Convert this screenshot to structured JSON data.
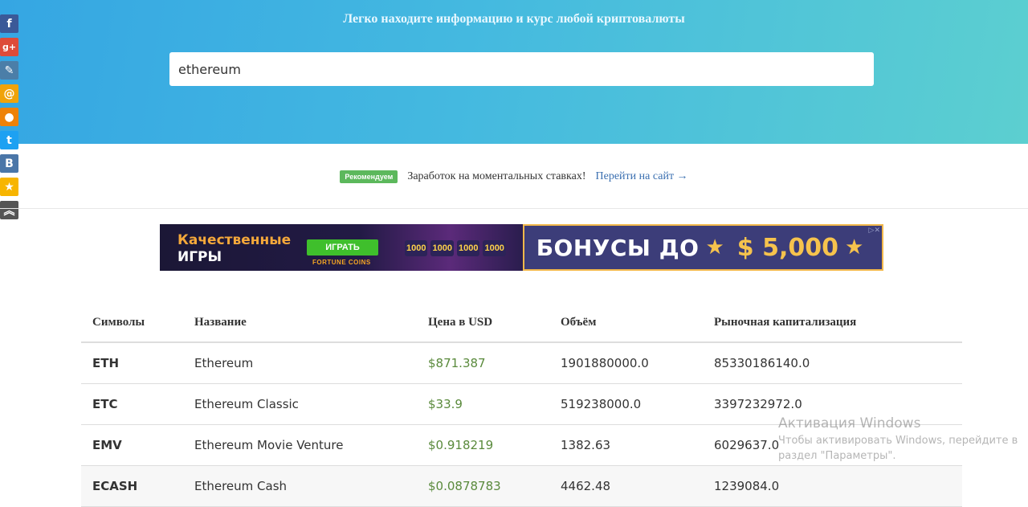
{
  "hero": {
    "subtitle": "Легко находите информацию и курс любой криптовалюты",
    "search_value": "ethereum"
  },
  "social": [
    {
      "icon": "facebook-icon",
      "glyph": "f",
      "color": "#3b5998"
    },
    {
      "icon": "google-plus-icon",
      "glyph": "g+",
      "color": "#dd4b39"
    },
    {
      "icon": "livejournal-icon",
      "glyph": "✎",
      "color": "#4b7ea8"
    },
    {
      "icon": "mail-ru-icon",
      "glyph": "@",
      "color": "#f0a30a"
    },
    {
      "icon": "odnoklassniki-icon",
      "glyph": "●",
      "color": "#ee8208"
    },
    {
      "icon": "twitter-icon",
      "glyph": "t",
      "color": "#1da1f2"
    },
    {
      "icon": "vk-icon",
      "glyph": "B",
      "color": "#4a76a8"
    },
    {
      "icon": "bookmark-star-icon",
      "glyph": "★",
      "color": "#f7b500"
    },
    {
      "icon": "scroll-up-icon",
      "glyph": "︽",
      "color": "#555555"
    }
  ],
  "promo": {
    "badge": "Рекомендуем",
    "text": "Заработок на моментальных ставках!",
    "link": "Перейти на сайт →"
  },
  "banner": {
    "left_title_1": "Качественные",
    "left_title_2": "ИГРЫ",
    "left_button": "ИГРАТЬ",
    "left_brand": "FORTUNE COINS",
    "reels": [
      "1000",
      "1000",
      "1000",
      "1000"
    ],
    "right_text": "БОНУСЫ ДО",
    "right_amount": "$ 5,000"
  },
  "table": {
    "headers": [
      "Символы",
      "Название",
      "Цена в USD",
      "Объём",
      "Рыночная капитализация"
    ],
    "rows": [
      {
        "symbol": "ETH",
        "name": "Ethereum",
        "price": "$871.387",
        "volume": "1901880000.0",
        "cap": "85330186140.0"
      },
      {
        "symbol": "ETC",
        "name": "Ethereum Classic",
        "price": "$33.9",
        "volume": "519238000.0",
        "cap": "3397232972.0"
      },
      {
        "symbol": "EMV",
        "name": "Ethereum Movie Venture",
        "price": "$0.918219",
        "volume": "1382.63",
        "cap": "6029637.0"
      },
      {
        "symbol": "ECASH",
        "name": "Ethereum Cash",
        "price": "$0.0878783",
        "volume": "4462.48",
        "cap": "1239084.0"
      }
    ]
  },
  "watermark": {
    "title": "Активация Windows",
    "line1": "Чтобы активировать Windows, перейдите в",
    "line2": "раздел \"Параметры\"."
  }
}
